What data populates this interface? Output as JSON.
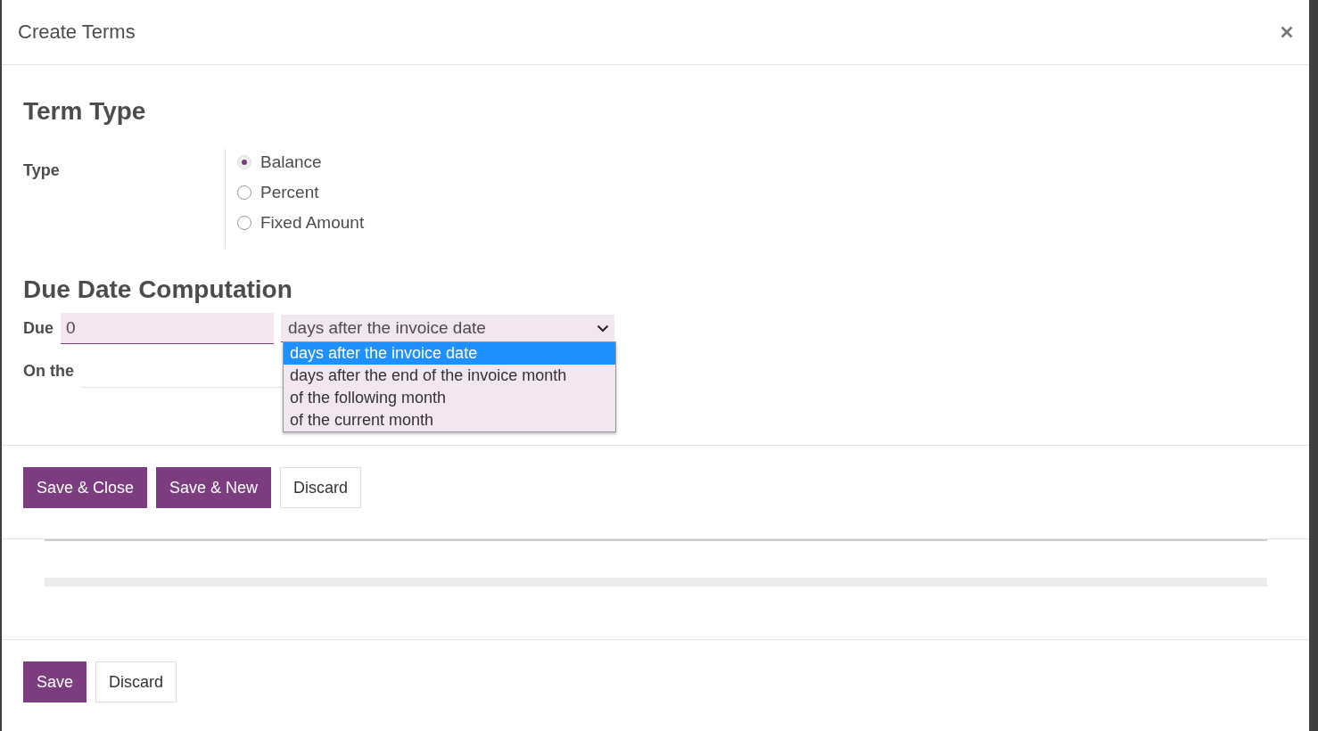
{
  "dialog": {
    "title": "Create Terms"
  },
  "term_type": {
    "heading": "Term Type",
    "label": "Type",
    "options": [
      {
        "label": "Balance",
        "selected": true
      },
      {
        "label": "Percent",
        "selected": false
      },
      {
        "label": "Fixed Amount",
        "selected": false
      }
    ]
  },
  "due_date": {
    "heading": "Due Date Computation",
    "due_label": "Due",
    "due_value": "0",
    "select_value": "days after the invoice date",
    "dropdown_options": [
      {
        "label": "days after the invoice date",
        "selected": true
      },
      {
        "label": "days after the end of the invoice month",
        "selected": false
      },
      {
        "label": "of the following month",
        "selected": false
      },
      {
        "label": "of the current month",
        "selected": false
      }
    ],
    "on_the_label": "On the"
  },
  "form_buttons": [
    {
      "label": "Save & Close",
      "kind": "primary"
    },
    {
      "label": "Save & New",
      "kind": "primary"
    },
    {
      "label": "Discard",
      "kind": "secondary"
    }
  ],
  "dialog_buttons": [
    {
      "label": "Save",
      "kind": "primary"
    },
    {
      "label": "Discard",
      "kind": "secondary"
    }
  ]
}
